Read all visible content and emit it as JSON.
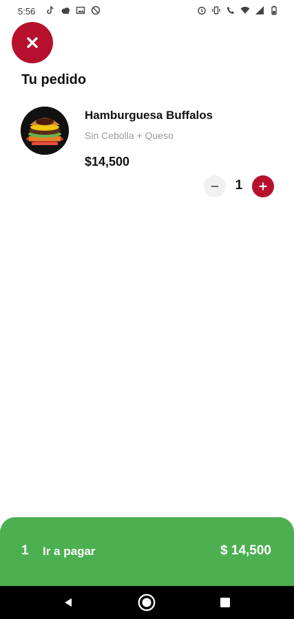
{
  "status_bar": {
    "time": "5:56",
    "left_icons": [
      "tiktok-icon",
      "cloud-icon",
      "photo-icon",
      "nosign-icon"
    ],
    "right_icons": [
      "alarm-icon",
      "vibrate-icon",
      "wifi-call-icon",
      "wifi-icon",
      "signal-icon",
      "battery-icon"
    ]
  },
  "header": {
    "close_icon": "close-icon",
    "title": "Tu pedido"
  },
  "order_items": [
    {
      "name": "Hamburguesa Buffalos",
      "options": "Sin Cebolla + Queso",
      "price": "$14,500",
      "quantity": "1"
    }
  ],
  "checkout": {
    "count": "1",
    "label": "Ir a pagar",
    "total": "$ 14,500"
  },
  "colors": {
    "accent": "#b7102e",
    "checkout": "#4caf50",
    "nav_bar": "#000000"
  },
  "nav_bar": {
    "buttons": [
      "back-icon",
      "home-icon",
      "recents-icon"
    ]
  }
}
